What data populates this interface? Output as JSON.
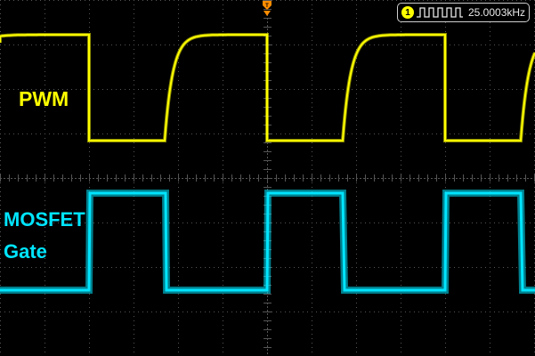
{
  "channels": {
    "ch1": {
      "label": "PWM",
      "color": "#ffff00"
    },
    "ch2": {
      "label_line1": "MOSFET",
      "label_line2": "Gate",
      "color": "#00e5ff"
    }
  },
  "frequency_readout": {
    "channel_number": "1",
    "channel_badge_color": "#ffff00",
    "wave_icon": "square-wave-icon",
    "value": "25.0003kHz"
  },
  "trigger_marker": {
    "icon": "trigger-position-icon",
    "color": "#ff8c00"
  },
  "grid": {
    "color": "#555555"
  }
}
